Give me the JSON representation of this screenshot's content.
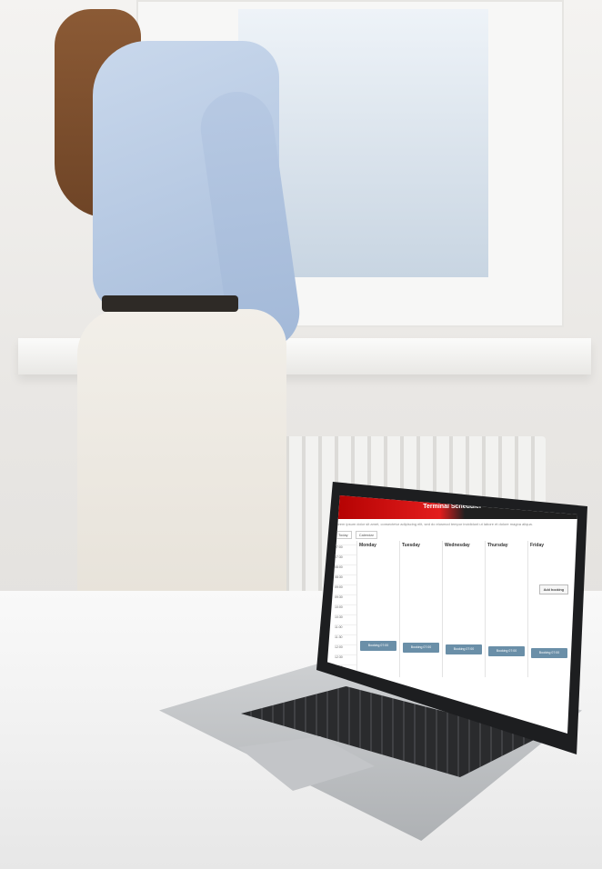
{
  "scene": {
    "description_colors": {
      "wall": "#ecebe8",
      "shirt": "#b7c9e3",
      "pants": "#ebe6dc",
      "laptop_body": "#c5c7ca",
      "app_accent": "#e31d1d",
      "slot_color": "#6a8fa8"
    }
  },
  "laptop_app": {
    "title": "Terminal Scheduler",
    "description": "Lorem ipsum dolor sit amet, consectetur adipiscing elit, sed do eiusmod tempor incididunt ut labore et dolore magna aliqua.",
    "toolbar": [
      "Today",
      "Calendar"
    ],
    "top_button": "Add booking",
    "columns": [
      "",
      "Monday",
      "Tuesday",
      "Wednesday",
      "Thursday",
      "Friday"
    ],
    "times": [
      "07:00",
      "07:30",
      "08:00",
      "08:30",
      "09:00",
      "09:30",
      "10:00",
      "10:30",
      "11:00",
      "11:30",
      "12:00",
      "12:30",
      "13:00",
      "13:30"
    ],
    "slots": [
      "Booking 07:00",
      "Booking 07:00",
      "Booking 07:00",
      "Booking 07:00",
      "Booking 07:00"
    ]
  }
}
